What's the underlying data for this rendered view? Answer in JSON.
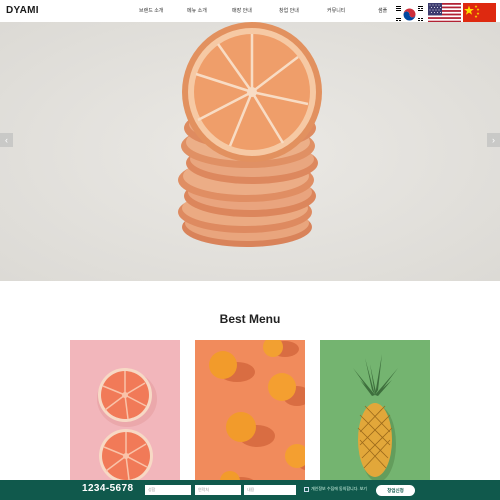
{
  "header": {
    "logo": "DYAMI",
    "nav": [
      "브랜드 소개",
      "메뉴 소개",
      "매장 안내",
      "창업 안내",
      "커뮤니티",
      "샘플"
    ],
    "flags": [
      {
        "name": "korea-flag",
        "label": "Korean"
      },
      {
        "name": "usa-flag",
        "label": "English"
      },
      {
        "name": "china-flag",
        "label": "Chinese"
      }
    ]
  },
  "hero": {
    "image": "stack of dried orange slices",
    "prev_label": "‹",
    "next_label": "›"
  },
  "best_menu": {
    "title": "Best Menu",
    "cards": [
      {
        "name": "grapefruit",
        "bg": "#f2b6bb"
      },
      {
        "name": "oranges",
        "bg": "#f18b5c"
      },
      {
        "name": "pineapple",
        "bg": "#74b470"
      }
    ]
  },
  "bottom_bar": {
    "phone": "1234-5678",
    "fields": [
      {
        "placeholder": "성함"
      },
      {
        "placeholder": "연락처"
      },
      {
        "placeholder": "내용"
      }
    ],
    "agree_label": "개인정보 수집에 동의합니다.  보기",
    "submit_label": "창업신청"
  },
  "colors": {
    "bottom_bar": "#10594c",
    "hero_bg": "#e5e3df"
  }
}
